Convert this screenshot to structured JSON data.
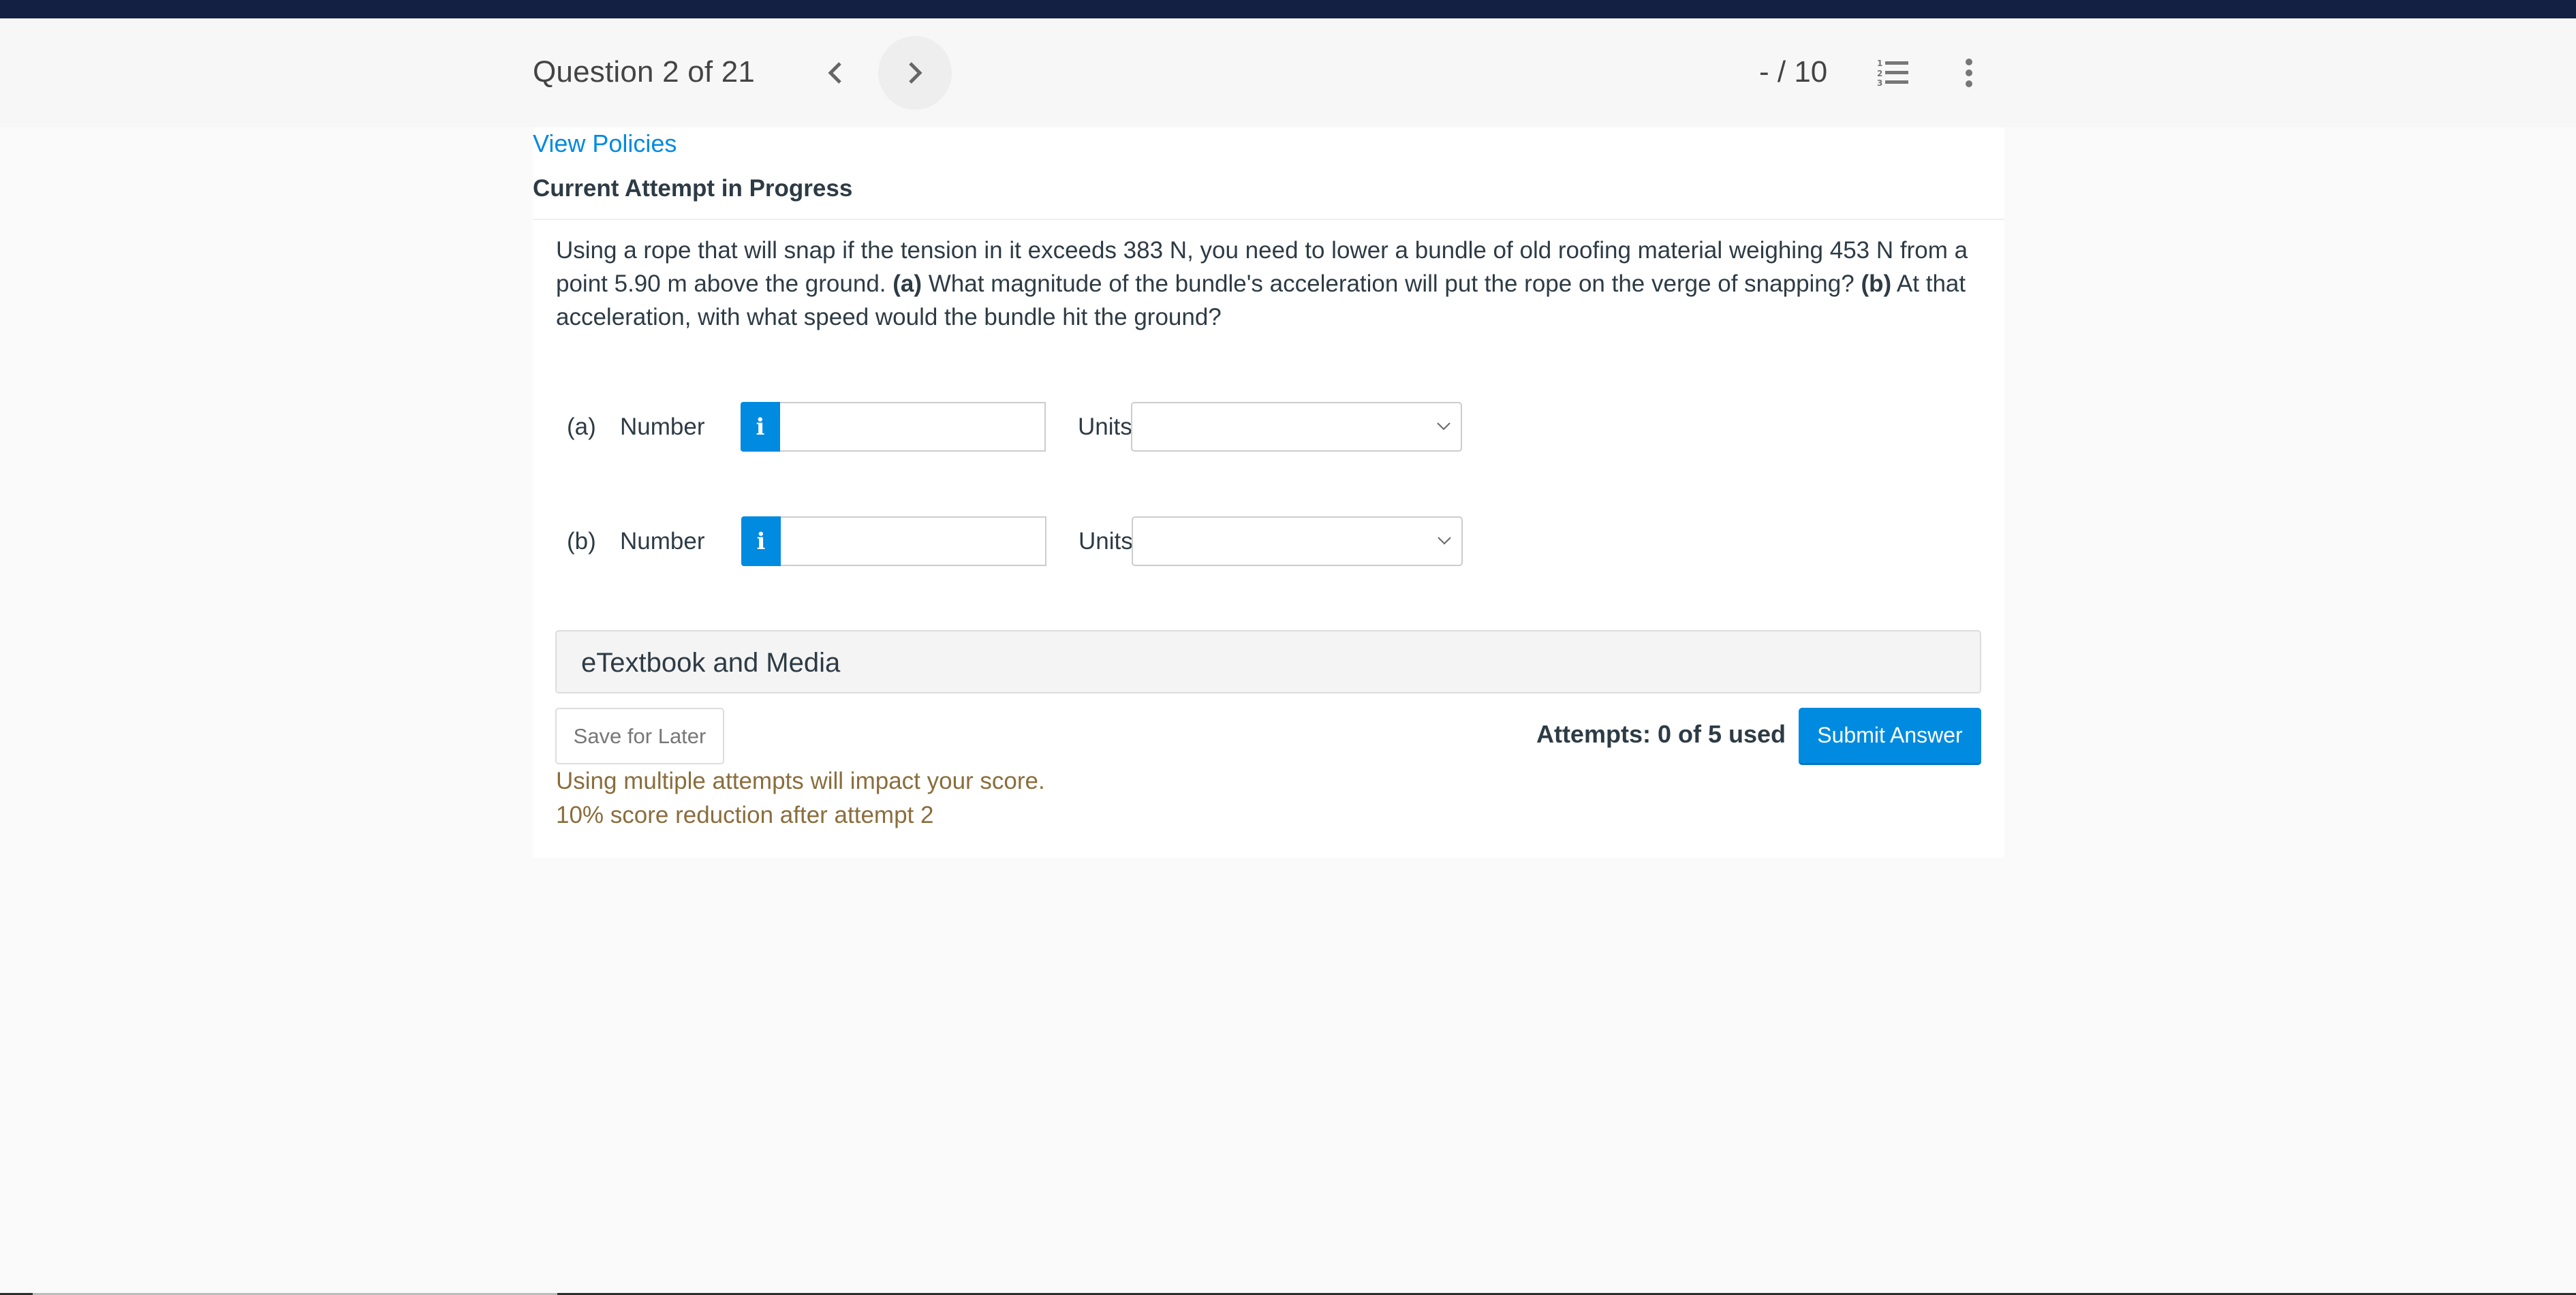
{
  "header": {
    "question_counter": "Question 2 of 21",
    "score": "- / 10",
    "prev_icon": "chevron-left-icon",
    "next_icon": "chevron-right-icon",
    "list_icon": "numbered-list-icon",
    "more_icon": "more-vertical-icon"
  },
  "links": {
    "view_policies": "View Policies"
  },
  "attempt_title": "Current Attempt in Progress",
  "question": {
    "text_1": "Using a rope that will snap if the tension in it exceeds 383 N, you need to lower a bundle of old roofing material weighing 453 N from a point 5.90 m above the ground. ",
    "part_a_marker": "(a)",
    "text_2": " What magnitude of the bundle's acceleration will put the rope on the verge of snapping? ",
    "part_b_marker": "(b)",
    "text_3": " At that acceleration, with what speed would the bundle hit the ground?"
  },
  "answers": [
    {
      "part": "(a)",
      "number_label": "Number",
      "info_icon": "i",
      "number_value": "",
      "units_label": "Units",
      "units_selected": ""
    },
    {
      "part": "(b)",
      "number_label": "Number",
      "info_icon": "i",
      "number_value": "",
      "units_label": "Units",
      "units_selected": ""
    }
  ],
  "etextbook": {
    "label": "eTextbook and Media"
  },
  "footer": {
    "save_label": "Save for Later",
    "attempts_text": "Attempts: 0 of 5 used",
    "submit_label": "Submit Answer",
    "warning_1": "Using multiple attempts will impact your score.",
    "warning_2": "10% score reduction after attempt 2"
  },
  "colors": {
    "accent": "#008ae0",
    "top_bar": "#141f44",
    "warning": "#8a6d3b",
    "text": "#2d3b45"
  }
}
